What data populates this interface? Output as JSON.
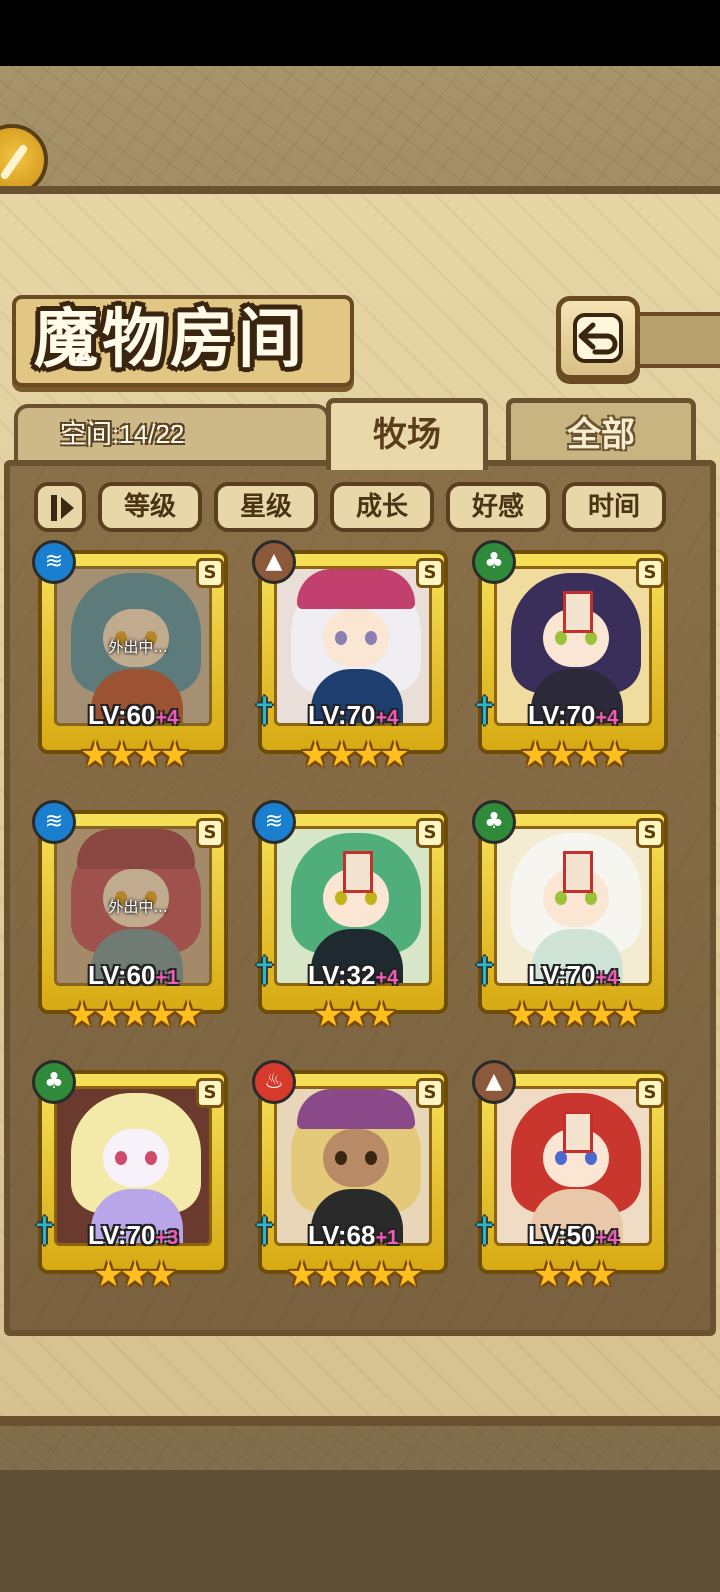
{
  "title": "魔物房间",
  "space_label": "空间:14/22",
  "tabs": [
    {
      "label": "牧场",
      "active": true
    },
    {
      "label": "全部",
      "active": false
    }
  ],
  "filters": [
    "等级",
    "星级",
    "成长",
    "好感",
    "时间"
  ],
  "icons": {
    "back": "back-arrow-icon",
    "sort": "sort-icon",
    "water": "water-element-icon",
    "earth": "earth-element-icon",
    "wood": "wood-element-icon",
    "fire": "fire-element-icon",
    "weapon": "sword-icon"
  },
  "colors": {
    "plus_level": "#f25cb8",
    "star": "#ffbf1f",
    "frame_gold": "#f7e15a"
  },
  "monsters": [
    {
      "element": "water",
      "rank": "S",
      "lv": "LV:60",
      "plus": "+4",
      "stars": 4,
      "status": "外出中..."
    },
    {
      "element": "earth",
      "rank": "S",
      "lv": "LV:70",
      "plus": "+4",
      "stars": 4
    },
    {
      "element": "wood",
      "rank": "S",
      "lv": "LV:70",
      "plus": "+4",
      "stars": 4
    },
    {
      "element": "water",
      "rank": "S",
      "lv": "LV:60",
      "plus": "+1",
      "stars": 5,
      "status": "外出中..."
    },
    {
      "element": "water",
      "rank": "S",
      "lv": "LV:32",
      "plus": "+4",
      "stars": 3
    },
    {
      "element": "wood",
      "rank": "S",
      "lv": "LV:70",
      "plus": "+4",
      "stars": 5
    },
    {
      "element": "wood",
      "rank": "S",
      "lv": "LV:70",
      "plus": "+3",
      "stars": 3
    },
    {
      "element": "fire",
      "rank": "S",
      "lv": "LV:68",
      "plus": "+1",
      "stars": 5
    },
    {
      "element": "earth",
      "rank": "S",
      "lv": "LV:50",
      "plus": "+4",
      "stars": 3
    }
  ],
  "stars_text": {
    "three": "★★★",
    "four": "★★★★",
    "five": "★★★★★"
  },
  "element_glyphs": {
    "water": "≋",
    "earth": "▲",
    "wood": "♣",
    "fire": "♨"
  },
  "weapon_glyph": "†"
}
